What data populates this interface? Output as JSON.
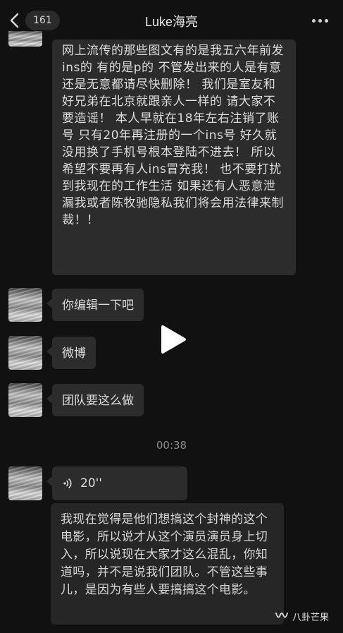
{
  "header": {
    "unread_count": "161",
    "title": "Luke海亮"
  },
  "messages": [
    {
      "type": "text",
      "text": "网上流传的那些图文有的是我五六年前发ins的 有的是p的 不管发出来的人是有意还是无意都请尽快删除！ 我们是室友和好兄弟在北京就跟亲人一样的 请大家不要造谣！ 本人早就在18年左右注销了账号 只有20年再注册的一个ins号 好久就没用换了手机号根本登陆不进去！ 所以希望不要再有人ins冒充我！ 也不要打扰到我现在的工作生活 如果还有人恶意泄漏我或者陈牧驰隐私我们将会用法律来制裁！！"
    },
    {
      "type": "text",
      "text": "你编辑一下吧"
    },
    {
      "type": "text",
      "text": "微博"
    },
    {
      "type": "text",
      "text": "团队要这么做"
    }
  ],
  "timestamp": "00:38",
  "voice": {
    "duration": "20''",
    "transcript": "我现在觉得是他们想搞这个封神的这个电影，所以说才从这个演员演员身上切入，所以说现在大家才这么混乱，你知道吗，并不是说我们团队。不管这些事儿，是因为有些人要搞搞这个电影。"
  },
  "watermark": {
    "text": "八卦芒果",
    "icon": "wechat-channel-icon"
  },
  "colors": {
    "background": "#111111",
    "bubble": "#2c2c2c",
    "text": "#dcdcdc"
  }
}
